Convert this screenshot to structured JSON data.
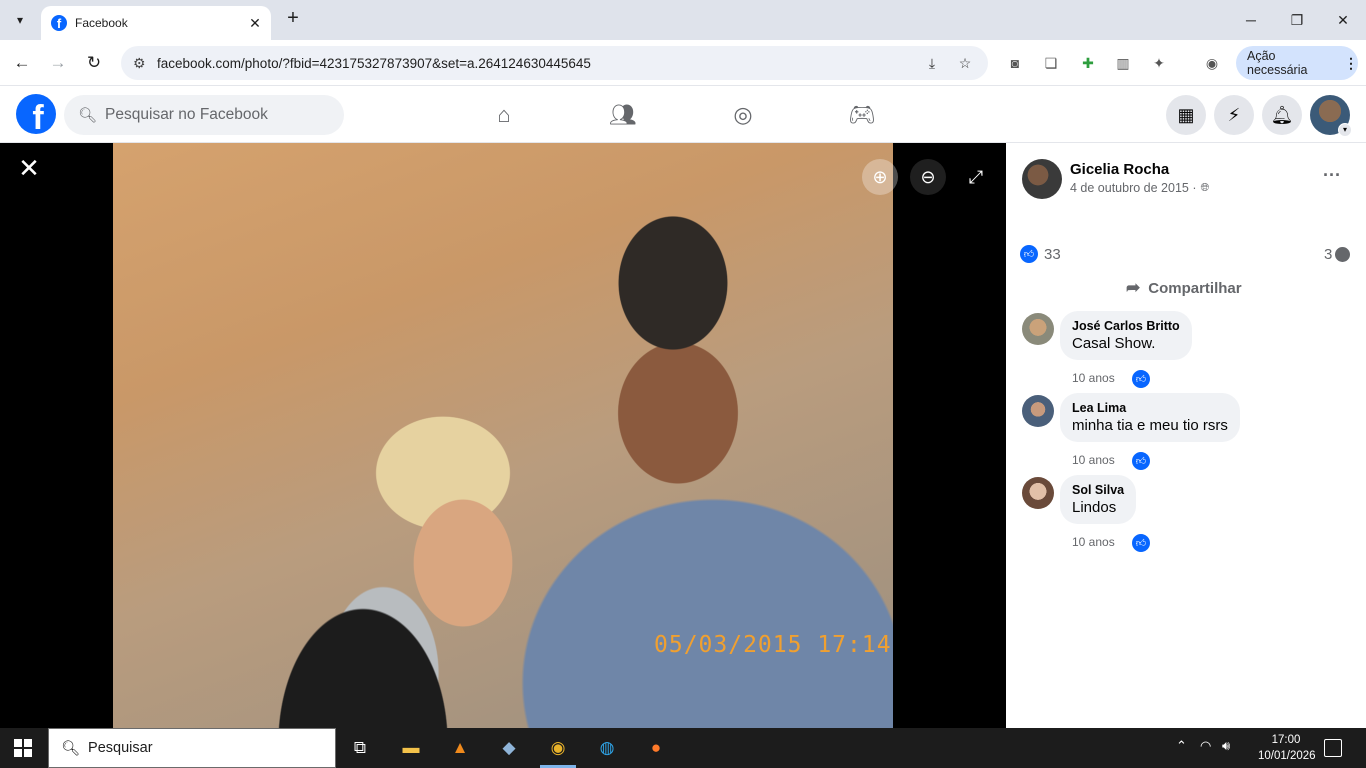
{
  "browser": {
    "tab_title": "Facebook",
    "url": "facebook.com/photo/?fbid=423175327873907&set=a.264124630445645",
    "action_label": "Ação necessária"
  },
  "fbnav": {
    "search_placeholder": "Pesquisar no Facebook",
    "logo_letter": "f"
  },
  "photo": {
    "timestamp_overlay": "05/03/2015  17:14"
  },
  "post": {
    "author": "Gicelia Rocha",
    "date": "4 de outubro de 2015 ·",
    "reaction_count": "33",
    "comment_count": "3",
    "share_label": "Compartilhar"
  },
  "comments": [
    {
      "name": "José Carlos Britto",
      "text": "Casal Show.",
      "time": "10 anos"
    },
    {
      "name": "Lea Lima",
      "text": "minha tia e meu tio rsrs",
      "time": "10 anos"
    },
    {
      "name": "Sol Silva",
      "text": "Lindos",
      "time": "10 anos"
    }
  ],
  "taskbar": {
    "search_placeholder": "Pesquisar",
    "time": "17:00",
    "date": "10/01/2026"
  },
  "colors": {
    "facebook_blue": "#0866ff",
    "panel_bg": "#ffffff",
    "viewer_bg": "#000000",
    "taskbar_bg": "#1c1c1c"
  }
}
